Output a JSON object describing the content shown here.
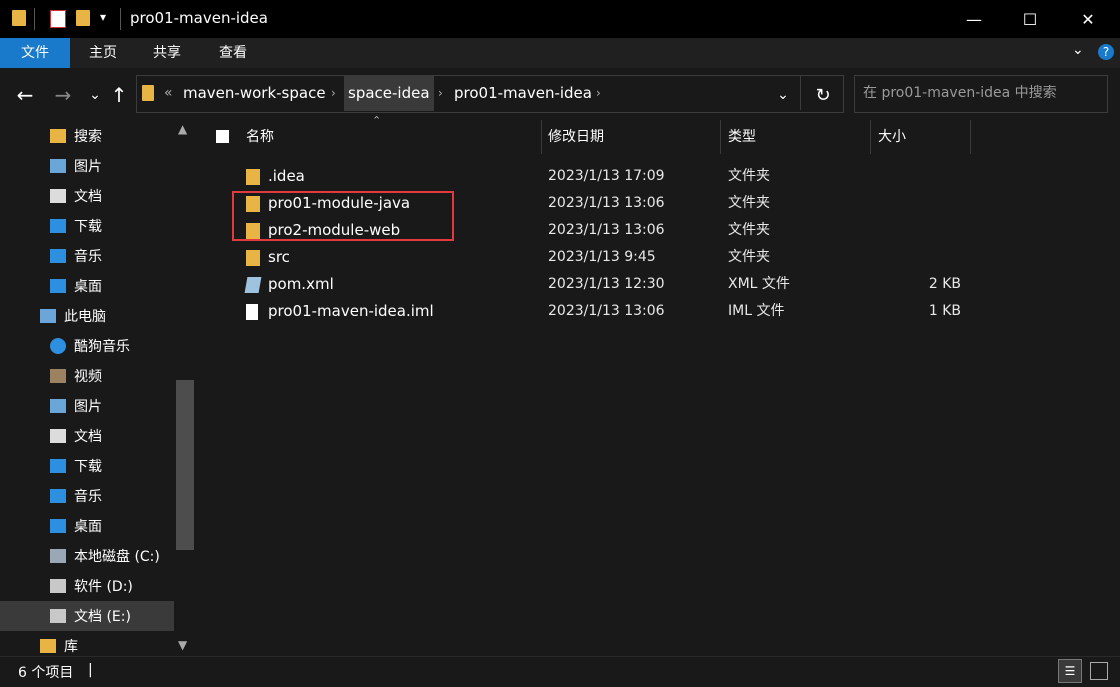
{
  "window": {
    "title": "pro01-maven-idea",
    "minimize_glyph": "—",
    "maximize_glyph": "☐",
    "close_glyph": "✕"
  },
  "ribbon": {
    "tabs": [
      "文件",
      "主页",
      "共享",
      "查看"
    ]
  },
  "nav": {
    "back_glyph": "←",
    "forward_glyph": "→",
    "recent_glyph": "⌄",
    "up_glyph": "↑",
    "refresh_glyph": "↻",
    "dropdown_glyph": "⌄",
    "overflow_glyph": "«",
    "breadcrumb": [
      "maven-work-space",
      "space-idea",
      "pro01-maven-idea"
    ]
  },
  "search": {
    "placeholder": "在 pro01-maven-idea 中搜索"
  },
  "sidebar": {
    "items": [
      {
        "label": "搜索",
        "icon": "search-folder-icon"
      },
      {
        "label": "图片",
        "icon": "pictures-icon"
      },
      {
        "label": "文档",
        "icon": "documents-icon"
      },
      {
        "label": "下载",
        "icon": "downloads-icon"
      },
      {
        "label": "音乐",
        "icon": "music-icon"
      },
      {
        "label": "桌面",
        "icon": "desktop-icon"
      },
      {
        "label": "此电脑",
        "icon": "this-pc-icon"
      },
      {
        "label": "酷狗音乐",
        "icon": "kugou-icon"
      },
      {
        "label": "视频",
        "icon": "videos-icon"
      },
      {
        "label": "图片",
        "icon": "pictures-icon"
      },
      {
        "label": "文档",
        "icon": "documents-icon"
      },
      {
        "label": "下载",
        "icon": "downloads-icon"
      },
      {
        "label": "音乐",
        "icon": "music-icon"
      },
      {
        "label": "桌面",
        "icon": "desktop-icon"
      },
      {
        "label": "本地磁盘 (C:)",
        "icon": "windows-drive-icon"
      },
      {
        "label": "软件 (D:)",
        "icon": "drive-icon"
      },
      {
        "label": "文档 (E:)",
        "icon": "drive-icon"
      },
      {
        "label": "库",
        "icon": "library-icon"
      }
    ]
  },
  "columns": {
    "name": "名称",
    "date": "修改日期",
    "type": "类型",
    "size": "大小"
  },
  "files": [
    {
      "name": ".idea",
      "date": "2023/1/13 17:09",
      "type": "文件夹",
      "size": "",
      "icon": "folder-icon"
    },
    {
      "name": "pro01-module-java",
      "date": "2023/1/13 13:06",
      "type": "文件夹",
      "size": "",
      "icon": "folder-icon"
    },
    {
      "name": "pro2-module-web",
      "date": "2023/1/13 13:06",
      "type": "文件夹",
      "size": "",
      "icon": "folder-icon"
    },
    {
      "name": "src",
      "date": "2023/1/13 9:45",
      "type": "文件夹",
      "size": "",
      "icon": "folder-icon"
    },
    {
      "name": "pom.xml",
      "date": "2023/1/13 12:30",
      "type": "XML 文件",
      "size": "2 KB",
      "icon": "xml-file-icon"
    },
    {
      "name": "pro01-maven-idea.iml",
      "date": "2023/1/13 13:06",
      "type": "IML 文件",
      "size": "1 KB",
      "icon": "file-icon"
    }
  ],
  "status": {
    "count_text": "6 个项目",
    "cursor": "|"
  },
  "colors": {
    "accent": "#1979ca",
    "folder": "#e8b544",
    "highlight_box": "#e0393e"
  }
}
